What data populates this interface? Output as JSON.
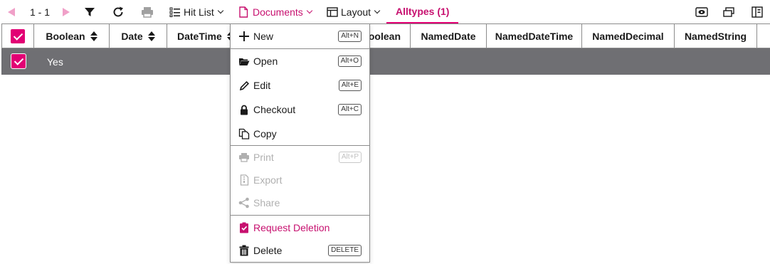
{
  "toolbar": {
    "pager": "1 - 1",
    "hit_list_label": "Hit List",
    "documents_label": "Documents",
    "layout_label": "Layout",
    "active_tab_label": "Alltypes (1)"
  },
  "grid": {
    "columns": [
      {
        "label": "Boolean",
        "sortable": true
      },
      {
        "label": "Date",
        "sortable": true
      },
      {
        "label": "DateTime",
        "sortable": true
      },
      {
        "label": "oolean",
        "sortable": false
      },
      {
        "label": "NamedDate",
        "sortable": false
      },
      {
        "label": "NamedDateTime",
        "sortable": false
      },
      {
        "label": "NamedDecimal",
        "sortable": false
      },
      {
        "label": "NamedString",
        "sortable": false
      }
    ],
    "rows": [
      {
        "selected": true,
        "cells": [
          "Yes"
        ]
      }
    ]
  },
  "menu": {
    "items": [
      {
        "label": "New",
        "shortcut": "Alt+N",
        "icon": "plus-icon",
        "state": "enabled"
      },
      {
        "label": "Open",
        "shortcut": "Alt+O",
        "icon": "folder-open-icon",
        "state": "enabled"
      },
      {
        "label": "Edit",
        "shortcut": "Alt+E",
        "icon": "pencil-icon",
        "state": "enabled"
      },
      {
        "label": "Checkout",
        "shortcut": "Alt+C",
        "icon": "lock-icon",
        "state": "enabled"
      },
      {
        "label": "Copy",
        "shortcut": "",
        "icon": "copy-icon",
        "state": "enabled"
      },
      {
        "label": "Print",
        "shortcut": "Alt+P",
        "icon": "printer-icon",
        "state": "disabled"
      },
      {
        "label": "Export",
        "shortcut": "",
        "icon": "export-icon",
        "state": "disabled"
      },
      {
        "label": "Share",
        "shortcut": "",
        "icon": "share-icon",
        "state": "disabled"
      },
      {
        "label": "Request Deletion",
        "shortcut": "",
        "icon": "request-deletion-icon",
        "state": "accent"
      },
      {
        "label": "Delete",
        "shortcut": "DELETE",
        "icon": "trash-icon",
        "state": "enabled"
      }
    ]
  },
  "colors": {
    "accent": "#e20074",
    "accent_text": "#c7106f",
    "row_selected_bg": "#6f6f73",
    "disabled_text": "#b0b0b0"
  }
}
